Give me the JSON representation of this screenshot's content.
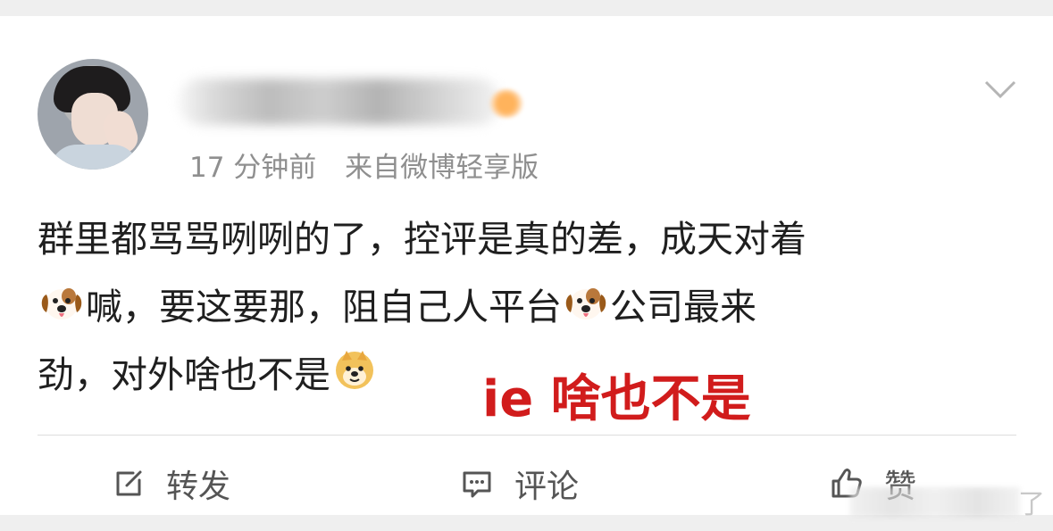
{
  "post": {
    "meta": {
      "time": "17 分钟前",
      "source": "来自微博轻享版"
    },
    "lines": {
      "line1": "群里都骂骂咧咧的了，控评是真的差，成天对着",
      "line2_part1": "喊，要这要那，阻自己人平台",
      "line2_part2": "公司最来",
      "line3": "劲，对外啥也不是"
    },
    "annotation": "ie 啥也不是"
  },
  "actions": {
    "repost": "转发",
    "comment": "评论",
    "like": "赞"
  },
  "watermark": {
    "char": "了"
  },
  "icons": {
    "avatar": "avatar",
    "more": "chevron-down-icon",
    "dog": "dog-emoji-icon",
    "doge": "doge-emoji-icon",
    "repost": "edit-box-icon",
    "comment": "message-icon",
    "like": "thumbs-up-icon"
  },
  "colors": {
    "text": "#1f1f1f",
    "meta": "#8f8f8f",
    "annotation": "#d11c1c",
    "divider": "#dddddd"
  }
}
